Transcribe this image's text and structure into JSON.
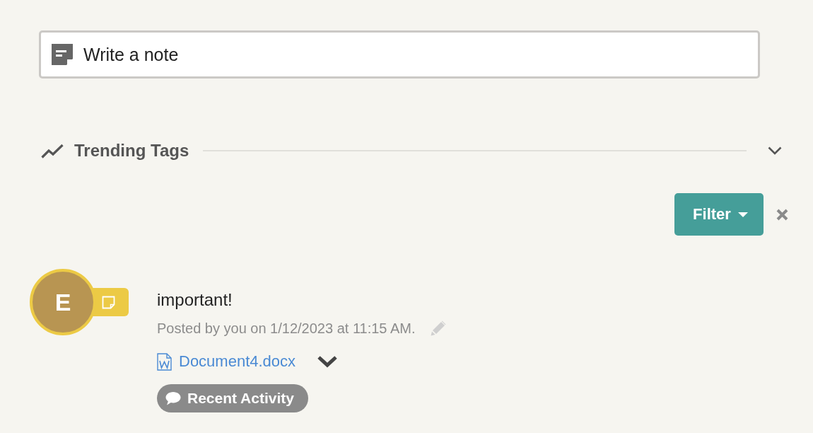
{
  "note_field": {
    "placeholder": "Write a note"
  },
  "trending_tags": {
    "title": "Trending Tags",
    "expanded": false
  },
  "filter": {
    "label": "Filter"
  },
  "posts": [
    {
      "avatar_initial": "E",
      "title": "important!",
      "meta": "Posted by you on 1/12/2023 at 11:15 AM.",
      "attachments": [
        {
          "name": "Document4.docx"
        }
      ],
      "activity_label": "Recent Activity"
    }
  ]
}
